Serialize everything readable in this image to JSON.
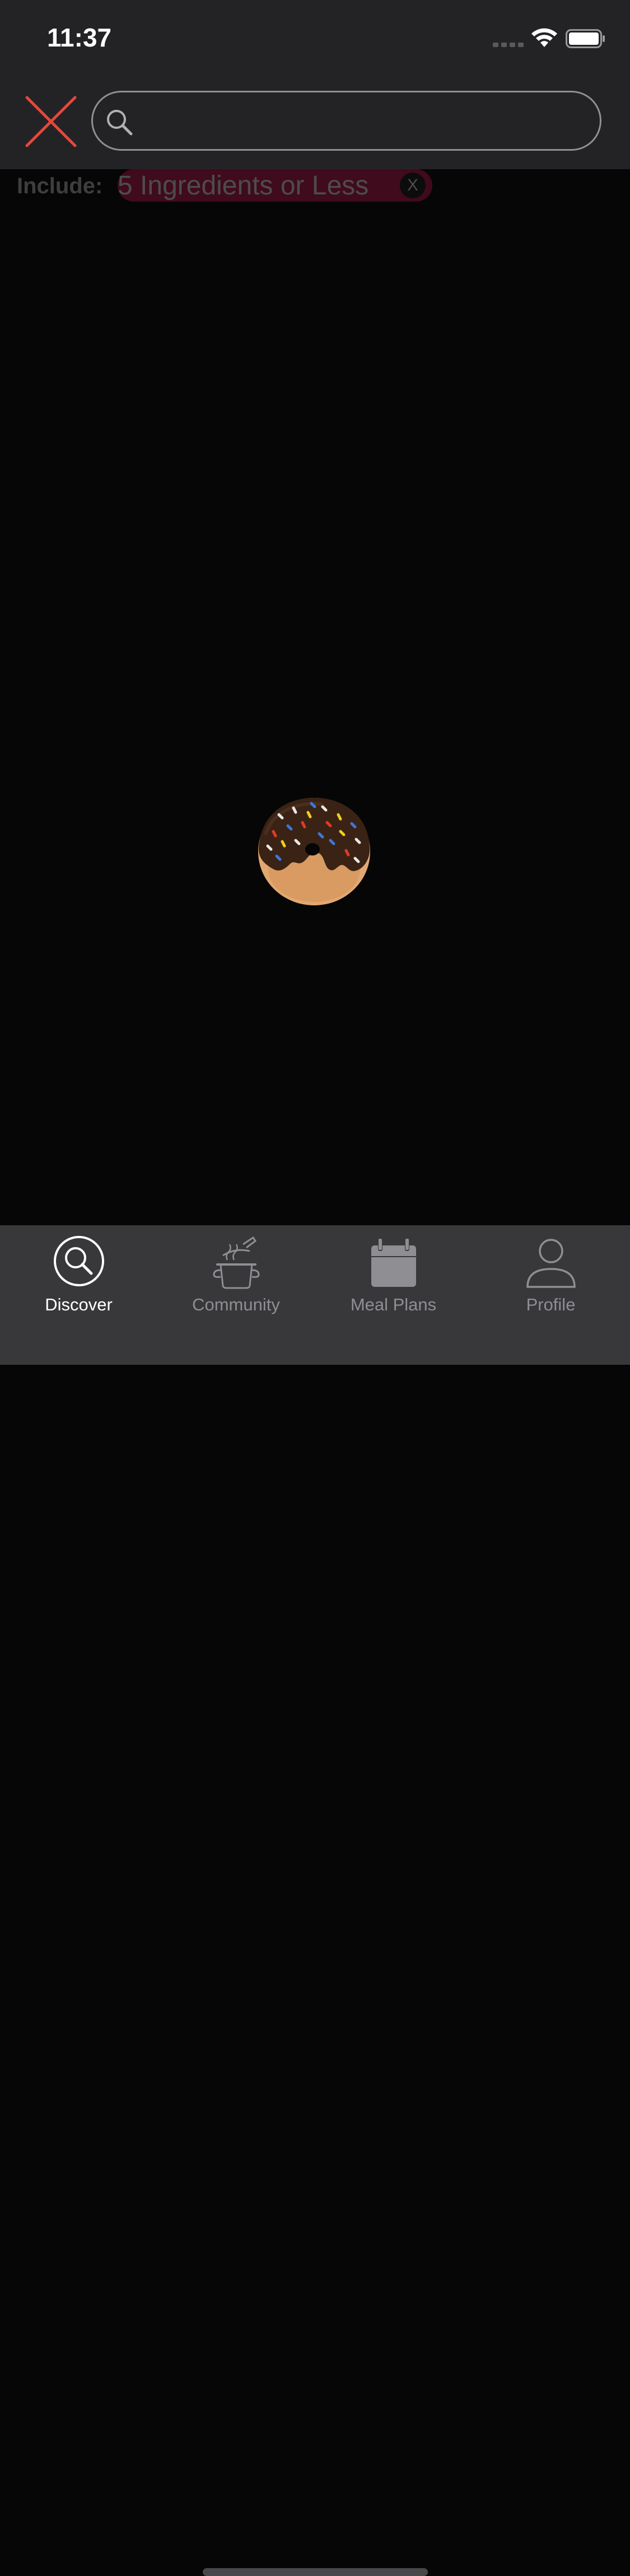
{
  "status_bar": {
    "time": "11:37"
  },
  "search": {
    "value": "",
    "placeholder": ""
  },
  "filters": {
    "include_label": "Include:",
    "chips": [
      {
        "label": "5 Ingredients or Less",
        "remove_label": "X"
      }
    ]
  },
  "tabs": [
    {
      "label": "Discover",
      "icon": "search-icon",
      "active": true
    },
    {
      "label": "Community",
      "icon": "cooking-pot-icon",
      "active": false
    },
    {
      "label": "Meal Plans",
      "icon": "calendar-icon",
      "active": false
    },
    {
      "label": "Profile",
      "icon": "person-icon",
      "active": false
    }
  ],
  "colors": {
    "close_accent": "#e5483c",
    "chip_accent": "#d51a55",
    "header_bg": "#232326",
    "tab_bar_bg": "#38383b",
    "content_bg": "#060606"
  }
}
